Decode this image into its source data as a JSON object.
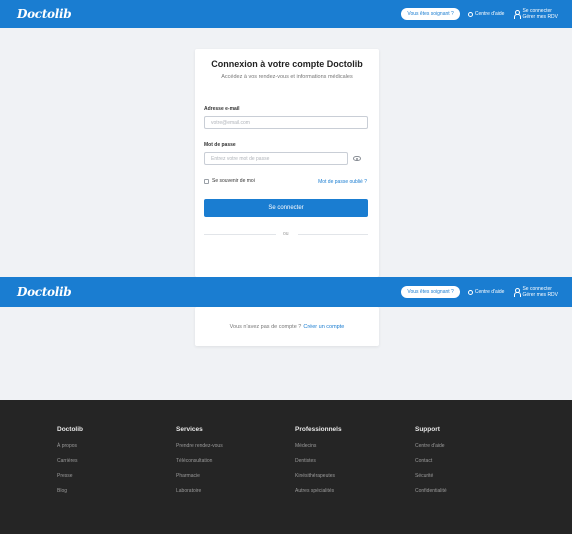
{
  "header": {
    "logo": "Doctolib",
    "pro_button": "Vous êtes soignant ?",
    "help": "Centre d'aide",
    "login_line1": "Se connecter",
    "login_line2": "Gérer mes RDV"
  },
  "login": {
    "title": "Connexion à votre compte Doctolib",
    "subtitle": "Accédez à vos rendez-vous et informations médicales",
    "email_label": "Adresse e-mail",
    "email_placeholder": "votre@email.com",
    "password_label": "Mot de passe",
    "password_placeholder": "Entrez votre mot de passe",
    "remember_label": "Se souvenir de moi",
    "forgot_link": "Mot de passe oublié ?",
    "submit_label": "Se connecter",
    "or_label": "ou"
  },
  "signup": {
    "prompt": "Vous n'avez pas de compte ?",
    "link": "Créer un compte"
  },
  "footer": {
    "columns": [
      {
        "title": "Doctolib",
        "links": [
          "À propos",
          "Carrières",
          "Presse",
          "Blog"
        ]
      },
      {
        "title": "Services",
        "links": [
          "Prendre rendez-vous",
          "Téléconsultation",
          "Pharmacie",
          "Laboratoire"
        ]
      },
      {
        "title": "Professionnels",
        "links": [
          "Médecins",
          "Dentistes",
          "Kinésithérapeutes",
          "Autres spécialités"
        ]
      },
      {
        "title": "Support",
        "links": [
          "Centre d'aide",
          "Contact",
          "Sécurité",
          "Confidentialité"
        ]
      }
    ]
  }
}
